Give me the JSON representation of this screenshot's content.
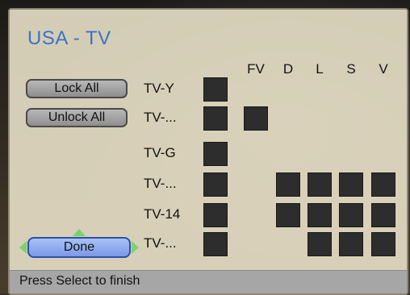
{
  "title": "USA - TV",
  "columns": [
    "FV",
    "D",
    "L",
    "S",
    "V"
  ],
  "buttons": {
    "lock_all": "Lock All",
    "unlock_all": "Unlock All",
    "done": "Done"
  },
  "ratings": [
    {
      "label": "TV-Y",
      "locked": true,
      "cells": [
        false,
        false,
        false,
        false,
        false
      ]
    },
    {
      "label": "TV-...",
      "locked": true,
      "cells": [
        true,
        false,
        false,
        false,
        false
      ]
    },
    {
      "label": "TV-G",
      "locked": true,
      "cells": [
        false,
        false,
        false,
        false,
        false
      ]
    },
    {
      "label": "TV-...",
      "locked": true,
      "cells": [
        false,
        true,
        true,
        true,
        true
      ]
    },
    {
      "label": "TV-14",
      "locked": true,
      "cells": [
        false,
        true,
        true,
        true,
        true
      ]
    },
    {
      "label": "TV-...",
      "locked": true,
      "cells": [
        false,
        false,
        true,
        true,
        true
      ]
    }
  ],
  "status": "Press Select to finish",
  "colors": {
    "title": "#3d72c6",
    "cell": "#2d2d2d",
    "focus": "#7ba0ee",
    "nav_arrows": "#7ad36c"
  }
}
